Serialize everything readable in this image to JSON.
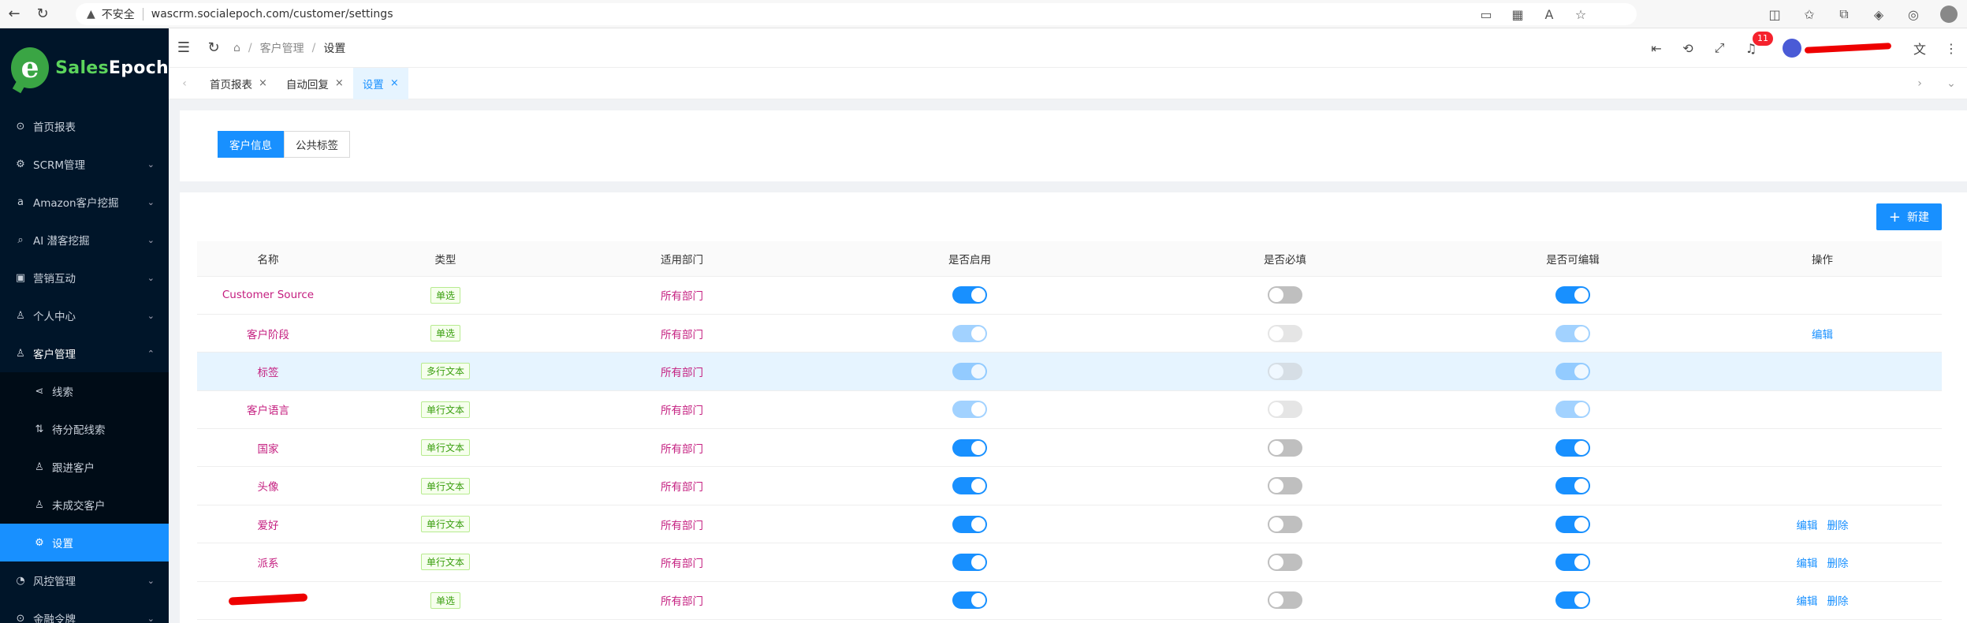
{
  "browser": {
    "security": "不安全",
    "url": "wascrm.socialepoch.com/customer/settings"
  },
  "logo": {
    "part1": "Sales",
    "part2": "Epoch"
  },
  "sidebar": {
    "items": [
      {
        "label": "首页报表",
        "icon": "home-icon"
      },
      {
        "label": "SCRM管理",
        "icon": "gear-icon"
      },
      {
        "label": "Amazon客户挖掘",
        "icon": "amazon-icon"
      },
      {
        "label": "AI 潜客挖掘",
        "icon": "search-icon"
      },
      {
        "label": "营销互动",
        "icon": "calendar-icon"
      },
      {
        "label": "个人中心",
        "icon": "user-icon"
      },
      {
        "label": "客户管理",
        "icon": "customers-icon"
      }
    ],
    "sub": [
      {
        "label": "线索"
      },
      {
        "label": "待分配线索"
      },
      {
        "label": "跟进客户"
      },
      {
        "label": "未成交客户"
      },
      {
        "label": "设置"
      }
    ],
    "tail": [
      {
        "label": "风控管理"
      },
      {
        "label": "金融令牌"
      }
    ]
  },
  "breadcrumb": {
    "l1": "客户管理",
    "l2": "设置"
  },
  "header": {
    "notification_count": "11"
  },
  "tabs": [
    {
      "label": "首页报表"
    },
    {
      "label": "自动回复"
    },
    {
      "label": "设置"
    }
  ],
  "segments": {
    "a": "客户信息",
    "b": "公共标签"
  },
  "new_button": "新建",
  "table": {
    "headers": [
      "名称",
      "类型",
      "适用部门",
      "是否启用",
      "是否必填",
      "是否可编辑",
      "操作"
    ],
    "rows": [
      {
        "name": "Customer Source",
        "type": "单选",
        "dept": "所有部门",
        "enabled": true,
        "required": false,
        "editable": true,
        "disabled": false,
        "actions": []
      },
      {
        "name": "客户阶段",
        "type": "单选",
        "dept": "所有部门",
        "enabled": true,
        "required": false,
        "editable": true,
        "disabled": true,
        "actions": [
          "编辑"
        ]
      },
      {
        "name": "标签",
        "type": "多行文本",
        "dept": "所有部门",
        "enabled": true,
        "required": false,
        "editable": true,
        "disabled": true,
        "actions": []
      },
      {
        "name": "客户语言",
        "type": "单行文本",
        "dept": "所有部门",
        "enabled": true,
        "required": false,
        "editable": true,
        "disabled": true,
        "actions": []
      },
      {
        "name": "国家",
        "type": "单行文本",
        "dept": "所有部门",
        "enabled": true,
        "required": false,
        "editable": true,
        "disabled": false,
        "actions": []
      },
      {
        "name": "头像",
        "type": "单行文本",
        "dept": "所有部门",
        "enabled": true,
        "required": false,
        "editable": true,
        "disabled": false,
        "actions": []
      },
      {
        "name": "爱好",
        "type": "单行文本",
        "dept": "所有部门",
        "enabled": true,
        "required": false,
        "editable": true,
        "disabled": false,
        "actions": [
          "编辑",
          "删除"
        ]
      },
      {
        "name": "派系",
        "type": "单行文本",
        "dept": "所有部门",
        "enabled": true,
        "required": false,
        "editable": true,
        "disabled": false,
        "actions": [
          "编辑",
          "删除"
        ]
      },
      {
        "name": "",
        "type": "单选",
        "dept": "所有部门",
        "enabled": true,
        "required": false,
        "editable": true,
        "disabled": false,
        "actions": [
          "编辑",
          "删除"
        ]
      }
    ]
  },
  "colors": {
    "primary": "#1890ff",
    "sidebar": "#001529",
    "name_text": "#c41d7f"
  }
}
